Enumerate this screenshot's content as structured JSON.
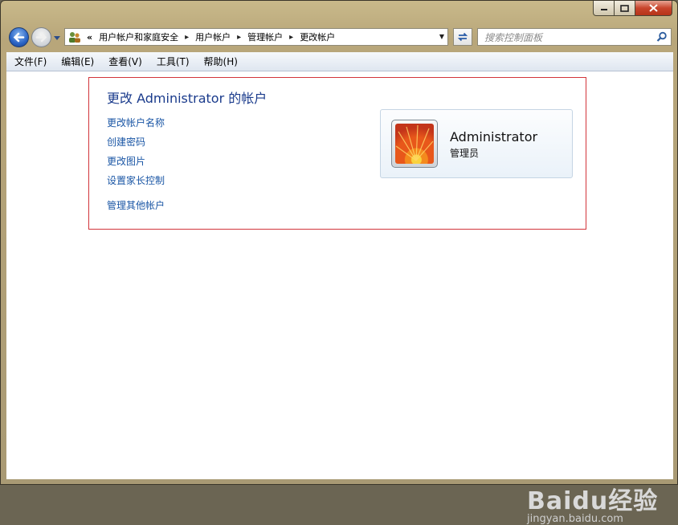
{
  "window": {
    "caption_minimize": "–",
    "caption_maximize": "□",
    "caption_close": "✕"
  },
  "nav": {
    "back_icon": "back-arrow-icon",
    "forward_icon": "forward-arrow-icon"
  },
  "address": {
    "overflow": "«",
    "crumbs": [
      "用户帐户和家庭安全",
      "用户帐户",
      "管理帐户",
      "更改帐户"
    ],
    "separator": "▸",
    "dropdown": "▼"
  },
  "search": {
    "placeholder": "搜索控制面板"
  },
  "menu": [
    "文件(F)",
    "编辑(E)",
    "查看(V)",
    "工具(T)",
    "帮助(H)"
  ],
  "panel": {
    "title": "更改 Administrator 的帐户",
    "links": [
      "更改帐户名称",
      "创建密码",
      "更改图片",
      "设置家长控制"
    ],
    "manage_link": "管理其他帐户"
  },
  "account": {
    "name": "Administrator",
    "role": "管理员"
  },
  "watermark": {
    "logo": "Baidu经验",
    "url": "jingyan.baidu.com"
  },
  "colors": {
    "panel_border": "#d2343a",
    "link": "#1a56a5",
    "heading": "#1a3b8c"
  }
}
